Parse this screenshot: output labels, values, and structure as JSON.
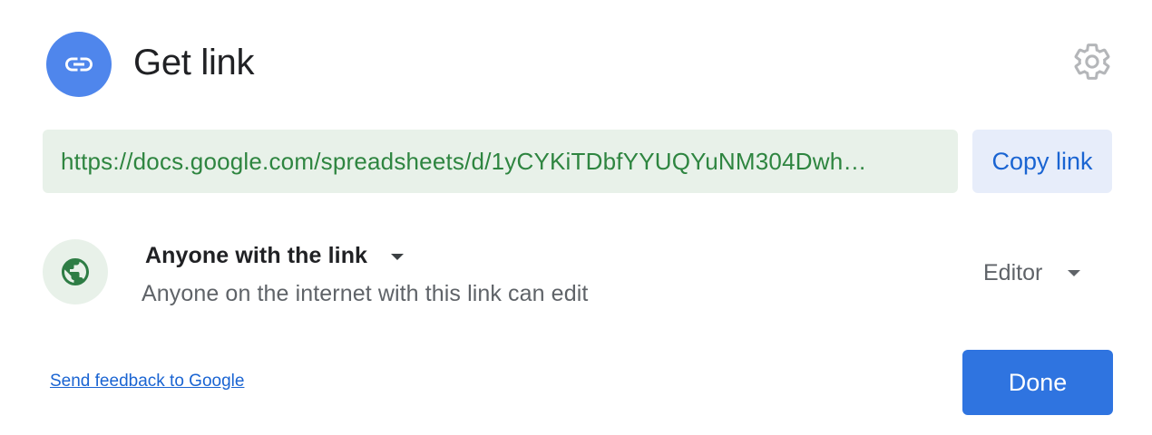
{
  "dialog": {
    "title": "Get link",
    "header_icon": "link-icon",
    "settings_icon": "gear-icon"
  },
  "link": {
    "url": "https://docs.google.com/spreadsheets/d/1yCYKiTDbfYYUQYuNM304Dwh…",
    "copy_label": "Copy link"
  },
  "access": {
    "icon": "globe-icon",
    "scope_label": "Anyone with the link",
    "description": "Anyone on the internet with this link can edit",
    "role_label": "Editor"
  },
  "footer": {
    "feedback_label": "Send feedback to Google",
    "done_label": "Done"
  },
  "colors": {
    "accent": "#1a64d2",
    "primary_button": "#2f74e0",
    "header_icon_bg": "#4f86ec",
    "url_bg": "#e8f1e9",
    "url_text": "#2e8540",
    "copy_button_bg": "#e7edfa",
    "globe": "#2e7d45"
  }
}
